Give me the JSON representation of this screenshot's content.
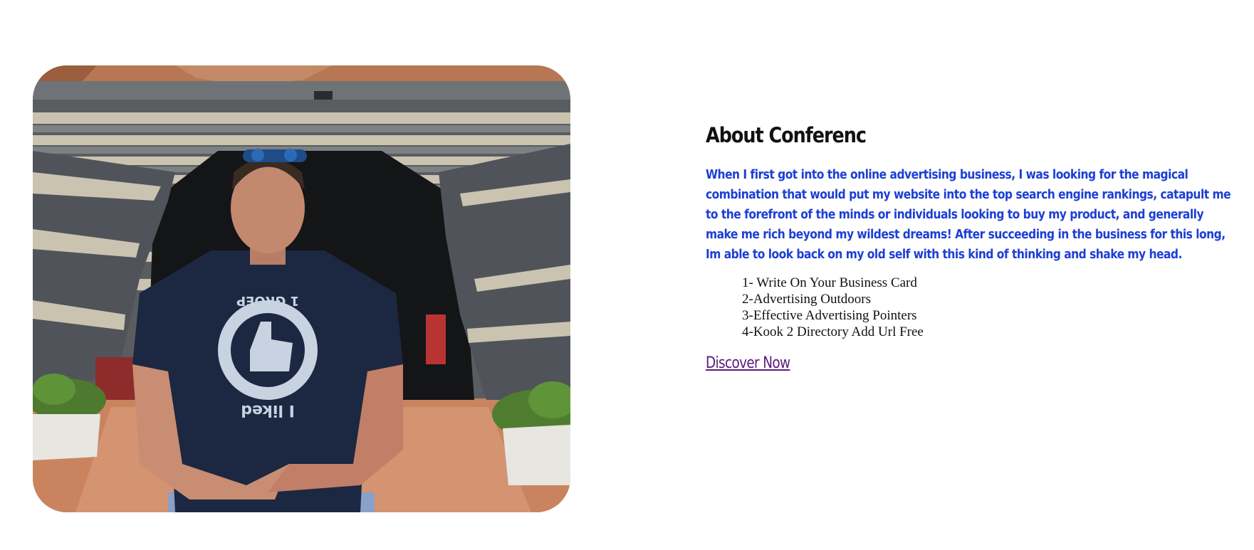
{
  "about": {
    "title": "About Conferenc",
    "paragraph": "When I first got into the online advertising business, I was looking for the magical combination that would put my website into the top search engine rankings, catapult me to the forefront of the minds or individuals looking to buy my product, and generally make me rich beyond my wildest dreams! After succeeding in the business for this long, Im able to look back on my old self with this kind of thinking and shake my head.",
    "tips": [
      "1- Write On Your Business Card",
      "2-Advertising Outdoors",
      "3-Effective Advertising Pointers",
      "4-Kook 2 Directory Add Url Free"
    ],
    "cta_label": "Discover Now"
  },
  "photo": {
    "shirt_text_top": "1 GROEP",
    "shirt_text_bottom": "I liked"
  },
  "colors": {
    "paragraph": "#1c3fd6",
    "link": "#5a1a7e",
    "title": "#111111"
  }
}
